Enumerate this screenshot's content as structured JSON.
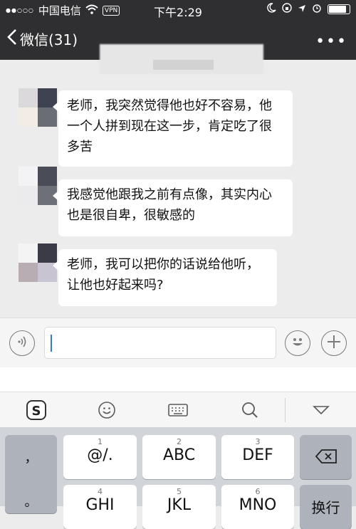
{
  "status_bar": {
    "carrier": "中国电信",
    "vpn": "VPN",
    "time": "下午2:29"
  },
  "nav": {
    "back_label": "微信(31)",
    "more_label": "•••"
  },
  "messages": [
    {
      "text": "老师，我突然觉得他也好不容易，他一个人拼到现在这一步，肯定吃了很多苦"
    },
    {
      "text": "我感觉他跟我之前有点像，其实内心也是很自卑，很敏感的"
    },
    {
      "text": "老师，我可以把你的话说给他听，让他也好起来吗?"
    }
  ],
  "input": {
    "value": ""
  },
  "keyboard": {
    "punct_key": "，",
    "period_key": "。",
    "keys": [
      {
        "num": "1",
        "letters": "@/."
      },
      {
        "num": "2",
        "letters": "ABC"
      },
      {
        "num": "3",
        "letters": "DEF"
      },
      {
        "num": "4",
        "letters": "GHI"
      },
      {
        "num": "5",
        "letters": "JKL"
      },
      {
        "num": "6",
        "letters": "MNO"
      }
    ],
    "line_break_key": "换行"
  },
  "colors": {
    "bar": "#2f2f31",
    "chat_bg": "#ececec",
    "bubble": "#ffffff",
    "cursor": "#2f7bd4"
  },
  "icons": [
    "wifi-icon",
    "location-icon",
    "moon-icon",
    "back-chevron-icon",
    "voice-icon",
    "emoji-icon",
    "plus-icon",
    "sogou-logo-icon",
    "smiley-icon",
    "keyboard-icon",
    "search-icon",
    "collapse-icon",
    "backspace-icon"
  ]
}
